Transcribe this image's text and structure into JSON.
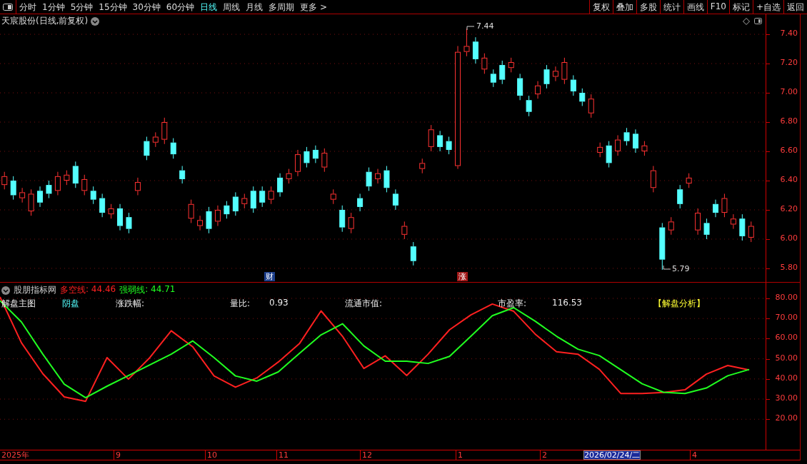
{
  "toolbar": {
    "periods": [
      {
        "label": "分时",
        "selected": false
      },
      {
        "label": "1分钟",
        "selected": false
      },
      {
        "label": "5分钟",
        "selected": false
      },
      {
        "label": "15分钟",
        "selected": false
      },
      {
        "label": "30分钟",
        "selected": false
      },
      {
        "label": "60分钟",
        "selected": false
      },
      {
        "label": "日线",
        "selected": true
      },
      {
        "label": "周线",
        "selected": false
      },
      {
        "label": "月线",
        "selected": false
      },
      {
        "label": "多周期",
        "selected": false
      },
      {
        "label": "更多 >",
        "selected": false
      }
    ],
    "buttons": [
      "复权",
      "叠加",
      "多股",
      "统计",
      "画线",
      "F10",
      "标记",
      "+自选",
      "返回"
    ]
  },
  "main_chart": {
    "title": "天宸股份(日线,前复权)",
    "high_label": "7.44",
    "low_label": "5.79",
    "chart_data": {
      "type": "candlestick",
      "grid": true,
      "ylim": [
        5.707,
        7.537
      ],
      "categories": [
        null,
        null,
        null,
        null,
        null,
        null,
        null,
        null,
        null,
        null,
        null,
        null,
        null,
        null,
        null,
        null,
        null,
        null,
        null,
        null,
        null,
        null,
        null,
        null,
        null,
        null,
        null,
        null,
        null,
        null,
        null,
        null,
        null,
        null,
        null,
        null,
        null,
        null,
        null,
        null,
        null,
        null,
        null,
        null,
        null,
        null,
        null,
        null,
        null,
        null,
        null,
        null,
        null,
        null,
        null,
        null,
        null,
        null,
        null,
        null,
        null,
        null,
        null,
        null,
        null,
        null,
        null,
        null,
        null,
        null,
        null,
        null,
        null,
        null,
        null,
        null,
        null,
        null,
        null,
        null,
        null,
        null,
        null,
        null,
        null
      ],
      "yticks": [
        {
          "value": 7.4,
          "label": "7.40"
        },
        {
          "value": 7.2,
          "label": "7.20"
        },
        {
          "value": 7.0,
          "label": "7.00"
        },
        {
          "value": 6.8,
          "label": "6.80"
        },
        {
          "value": 6.6,
          "label": "6.60"
        },
        {
          "value": 6.4,
          "label": "6.40"
        },
        {
          "value": 6.2,
          "label": "6.20"
        },
        {
          "value": 6.0,
          "label": "6.00"
        },
        {
          "value": 5.8,
          "label": "5.80"
        }
      ],
      "ohlc": [
        [
          6.37,
          6.46,
          6.34,
          6.43
        ],
        [
          6.4,
          6.43,
          6.27,
          6.3
        ],
        [
          6.28,
          6.35,
          6.25,
          6.32
        ],
        [
          6.19,
          6.34,
          6.16,
          6.31
        ],
        [
          6.33,
          6.36,
          6.22,
          6.25
        ],
        [
          6.37,
          6.4,
          6.28,
          6.31
        ],
        [
          6.33,
          6.46,
          6.3,
          6.43
        ],
        [
          6.4,
          6.47,
          6.37,
          6.44
        ],
        [
          6.5,
          6.53,
          6.35,
          6.38
        ],
        [
          6.33,
          6.44,
          6.3,
          6.41
        ],
        [
          6.33,
          6.36,
          6.24,
          6.27
        ],
        [
          6.28,
          6.31,
          6.15,
          6.18
        ],
        [
          6.17,
          6.24,
          6.14,
          6.21
        ],
        [
          6.21,
          6.24,
          6.06,
          6.09
        ],
        [
          6.15,
          6.18,
          6.04,
          6.07
        ],
        [
          6.33,
          6.42,
          6.3,
          6.39
        ],
        [
          6.67,
          6.7,
          6.54,
          6.57
        ],
        [
          6.66,
          6.73,
          6.63,
          6.7
        ],
        [
          6.68,
          6.83,
          6.65,
          6.8
        ],
        [
          6.66,
          6.69,
          6.55,
          6.58
        ],
        [
          6.47,
          6.5,
          6.38,
          6.41
        ],
        [
          6.14,
          6.27,
          6.11,
          6.24
        ],
        [
          6.09,
          6.16,
          6.06,
          6.13
        ],
        [
          6.19,
          6.22,
          6.04,
          6.07
        ],
        [
          6.12,
          6.23,
          6.09,
          6.2
        ],
        [
          6.23,
          6.26,
          6.14,
          6.17
        ],
        [
          6.29,
          6.32,
          6.16,
          6.19
        ],
        [
          6.24,
          6.31,
          6.21,
          6.28
        ],
        [
          6.33,
          6.36,
          6.18,
          6.21
        ],
        [
          6.33,
          6.36,
          6.22,
          6.25
        ],
        [
          6.27,
          6.36,
          6.24,
          6.33
        ],
        [
          6.42,
          6.45,
          6.29,
          6.32
        ],
        [
          6.41,
          6.48,
          6.38,
          6.45
        ],
        [
          6.46,
          6.61,
          6.43,
          6.58
        ],
        [
          6.6,
          6.63,
          6.49,
          6.52
        ],
        [
          6.61,
          6.64,
          6.52,
          6.55
        ],
        [
          6.49,
          6.62,
          6.46,
          6.59
        ],
        [
          6.27,
          6.34,
          6.24,
          6.31
        ],
        [
          6.2,
          6.23,
          6.05,
          6.08
        ],
        [
          6.07,
          6.18,
          6.04,
          6.15
        ],
        [
          6.28,
          6.31,
          6.19,
          6.22
        ],
        [
          6.46,
          6.49,
          6.33,
          6.36
        ],
        [
          6.41,
          6.48,
          6.38,
          6.45
        ],
        [
          6.47,
          6.5,
          6.32,
          6.35
        ],
        [
          6.31,
          6.34,
          6.2,
          6.23
        ],
        [
          6.03,
          6.12,
          6.0,
          6.09
        ],
        [
          5.95,
          5.98,
          5.82,
          5.85
        ],
        [
          6.48,
          6.55,
          6.45,
          6.52
        ],
        [
          6.63,
          6.78,
          6.6,
          6.75
        ],
        [
          6.71,
          6.74,
          6.6,
          6.63
        ],
        [
          6.67,
          6.7,
          6.58,
          6.61
        ],
        [
          6.5,
          7.32,
          6.48,
          7.28
        ],
        [
          7.28,
          7.44,
          7.25,
          7.32
        ],
        [
          7.35,
          7.38,
          7.2,
          7.23
        ],
        [
          7.16,
          7.27,
          7.13,
          7.24
        ],
        [
          7.13,
          7.16,
          7.04,
          7.07
        ],
        [
          7.19,
          7.22,
          7.06,
          7.09
        ],
        [
          7.17,
          7.24,
          7.14,
          7.21
        ],
        [
          7.1,
          7.13,
          6.95,
          6.98
        ],
        [
          6.95,
          6.98,
          6.84,
          6.87
        ],
        [
          6.99,
          7.08,
          6.96,
          7.05
        ],
        [
          7.16,
          7.19,
          7.03,
          7.06
        ],
        [
          7.11,
          7.18,
          7.08,
          7.15
        ],
        [
          7.09,
          7.24,
          7.06,
          7.21
        ],
        [
          7.09,
          7.12,
          6.98,
          7.01
        ],
        [
          7.0,
          7.03,
          6.91,
          6.94
        ],
        [
          6.86,
          6.99,
          6.83,
          6.96
        ],
        [
          6.59,
          6.66,
          6.56,
          6.63
        ],
        [
          6.64,
          6.67,
          6.49,
          6.52
        ],
        [
          6.6,
          6.71,
          6.57,
          6.68
        ],
        [
          6.73,
          6.76,
          6.64,
          6.67
        ],
        [
          6.72,
          6.75,
          6.59,
          6.62
        ],
        [
          6.6,
          6.67,
          6.57,
          6.64
        ],
        [
          6.35,
          6.5,
          6.32,
          6.47
        ],
        [
          6.08,
          6.11,
          5.79,
          5.86
        ],
        [
          6.06,
          6.15,
          6.03,
          6.12
        ],
        [
          6.34,
          6.37,
          6.21,
          6.24
        ],
        [
          6.38,
          6.45,
          6.35,
          6.42
        ],
        [
          6.06,
          6.21,
          6.03,
          6.18
        ],
        [
          6.11,
          6.14,
          6.0,
          6.03
        ],
        [
          6.24,
          6.27,
          6.15,
          6.18
        ],
        [
          6.18,
          6.31,
          6.15,
          6.28
        ],
        [
          6.1,
          6.17,
          6.07,
          6.14
        ],
        [
          6.14,
          6.17,
          5.99,
          6.02
        ],
        [
          6.01,
          6.12,
          5.98,
          6.09
        ]
      ]
    },
    "event_markers": [
      {
        "label": "财",
        "color": "#1c3f8c"
      },
      {
        "label": "涨",
        "color": "#a01818"
      }
    ]
  },
  "indicator": {
    "name": "股朋指标网",
    "legend_values": [
      ": 44.46",
      ": 44.71"
    ],
    "fields": [
      {
        "text": "解盘主图",
        "kind": "label"
      },
      {
        "text": "阴盘",
        "kind": "tag"
      },
      {
        "text": "涨跌幅:",
        "kind": "label"
      },
      {
        "text": "量比:",
        "kind": "label"
      },
      {
        "text": "0.93",
        "kind": "value"
      },
      {
        "text": "流通市值:",
        "kind": "label"
      },
      {
        "text": "市盈率:",
        "kind": "label"
      },
      {
        "text": "116.53",
        "kind": "value"
      },
      {
        "text": "【解盘分析】",
        "kind": "link"
      }
    ],
    "chart_data": {
      "type": "line",
      "grid": true,
      "categories": [
        null,
        null,
        null,
        null,
        null,
        null,
        null,
        null,
        null,
        null,
        null,
        null,
        null,
        null,
        null,
        null,
        null,
        null,
        null,
        null,
        null,
        null,
        null,
        null,
        null,
        null,
        null,
        null,
        null,
        null,
        null,
        null,
        null,
        null,
        null,
        null
      ],
      "ylim": [
        4.5,
        87.8
      ],
      "yticks": [
        {
          "value": 80,
          "label": "80.00"
        },
        {
          "value": 70,
          "label": "70.00"
        },
        {
          "value": 60,
          "label": "60.00"
        },
        {
          "value": 50,
          "label": "50.00"
        },
        {
          "value": 40,
          "label": "40.00"
        },
        {
          "value": 30,
          "label": "30.00"
        },
        {
          "value": 20,
          "label": "20.00"
        }
      ],
      "series": [
        {
          "name": "多空线",
          "color": "#ff2020",
          "values": [
            80.7,
            58.0,
            42.6,
            31.1,
            28.9,
            50.6,
            39.9,
            50.6,
            63.9,
            56.0,
            41.5,
            35.9,
            40.5,
            48.4,
            57.7,
            73.8,
            61.2,
            45.2,
            51.5,
            41.7,
            52.3,
            64.4,
            71.8,
            77.2,
            73.6,
            62.3,
            53.5,
            52.3,
            44.8,
            32.8,
            32.8,
            33.3,
            34.6,
            42.4,
            46.7,
            44.5
          ]
        },
        {
          "name": "强弱线",
          "color": "#20ff20",
          "values": [
            78.9,
            68.3,
            52.3,
            37.4,
            30.7,
            36.4,
            41.7,
            47.0,
            52.3,
            58.9,
            50.6,
            41.5,
            38.9,
            43.5,
            52.8,
            61.9,
            67.4,
            56.4,
            48.8,
            48.8,
            47.7,
            51.2,
            61.2,
            71.4,
            75.4,
            68.7,
            61.2,
            54.8,
            51.6,
            44.6,
            37.6,
            33.4,
            32.8,
            35.5,
            41.6,
            44.7
          ]
        }
      ]
    }
  },
  "date_axis": [
    {
      "label": "2025年",
      "selected": false
    },
    {
      "label": "9",
      "selected": false
    },
    {
      "label": "10",
      "selected": false
    },
    {
      "label": "11",
      "selected": false
    },
    {
      "label": "12",
      "selected": false
    },
    {
      "label": "1",
      "selected": false
    },
    {
      "label": "2",
      "selected": false
    },
    {
      "label": "2026/02/24/二",
      "selected": true
    },
    {
      "label": "4",
      "selected": false
    }
  ]
}
